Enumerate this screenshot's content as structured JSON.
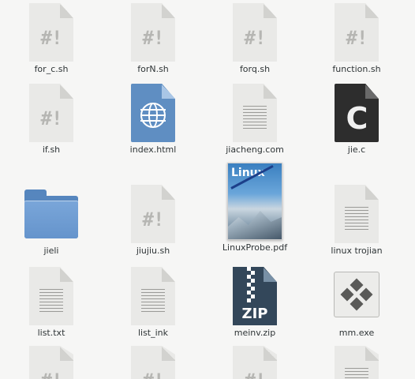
{
  "files": [
    {
      "name": "for_c.sh",
      "icon": "shell-script-icon",
      "glyph": "#!"
    },
    {
      "name": "forN.sh",
      "icon": "shell-script-icon",
      "glyph": "#!"
    },
    {
      "name": "forq.sh",
      "icon": "shell-script-icon",
      "glyph": "#!"
    },
    {
      "name": "function.sh",
      "icon": "shell-script-icon",
      "glyph": "#!"
    },
    {
      "name": "if.sh",
      "icon": "shell-script-icon",
      "glyph": "#!"
    },
    {
      "name": "index.html",
      "icon": "html-file-icon"
    },
    {
      "name": "jiacheng.com",
      "icon": "text-file-icon"
    },
    {
      "name": "jie.c",
      "icon": "c-source-file-icon",
      "glyph": "C"
    },
    {
      "name": "jieli",
      "icon": "folder-icon"
    },
    {
      "name": "jiujiu.sh",
      "icon": "shell-script-icon",
      "glyph": "#!"
    },
    {
      "name": "LinuxProbe.pdf",
      "icon": "pdf-thumbnail-icon",
      "cover_title": "Linux"
    },
    {
      "name": "linux trojian",
      "icon": "text-file-icon"
    },
    {
      "name": "list.txt",
      "icon": "text-file-icon"
    },
    {
      "name": "list_ink",
      "icon": "text-file-icon"
    },
    {
      "name": "meinv.zip",
      "icon": "zip-archive-icon",
      "glyph": "ZIP"
    },
    {
      "name": "mm.exe",
      "icon": "executable-icon"
    }
  ],
  "partial_row": [
    {
      "icon": "shell-script-icon",
      "glyph": "#!"
    },
    {
      "icon": "shell-script-icon",
      "glyph": "#!"
    },
    {
      "icon": "shell-script-icon",
      "glyph": "#!"
    },
    {
      "icon": "text-file-icon"
    }
  ]
}
